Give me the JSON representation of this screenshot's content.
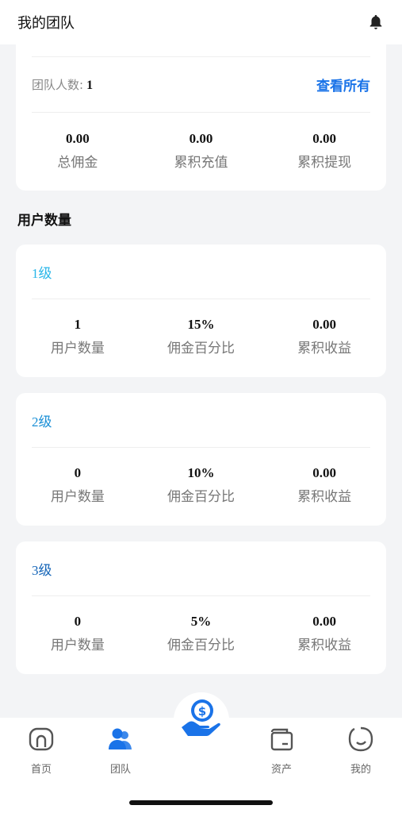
{
  "header": {
    "title": "我的团队"
  },
  "team": {
    "count_label": "团队人数:",
    "count_value": "1",
    "view_all": "查看所有",
    "stats": [
      {
        "value": "0.00",
        "label": "总佣金"
      },
      {
        "value": "0.00",
        "label": "累积充值"
      },
      {
        "value": "0.00",
        "label": "累积提现"
      }
    ]
  },
  "section_title": "用户数量",
  "levels": [
    {
      "title": "1级",
      "color": "#29b6e8",
      "stats": [
        {
          "value": "1",
          "label": "用户数量"
        },
        {
          "value": "15%",
          "label": "佣金百分比"
        },
        {
          "value": "0.00",
          "label": "累积收益"
        }
      ]
    },
    {
      "title": "2级",
      "color": "#1a8fd6",
      "stats": [
        {
          "value": "0",
          "label": "用户数量"
        },
        {
          "value": "10%",
          "label": "佣金百分比"
        },
        {
          "value": "0.00",
          "label": "累积收益"
        }
      ]
    },
    {
      "title": "3级",
      "color": "#1565b8",
      "stats": [
        {
          "value": "0",
          "label": "用户数量"
        },
        {
          "value": "5%",
          "label": "佣金百分比"
        },
        {
          "value": "0.00",
          "label": "累积收益"
        }
      ]
    }
  ],
  "tabbar": {
    "items": [
      {
        "label": "首页",
        "icon": "home-icon"
      },
      {
        "label": "团队",
        "icon": "team-icon",
        "active": true
      },
      {
        "label": "",
        "icon": "money-hand-icon",
        "center": true
      },
      {
        "label": "资产",
        "icon": "wallet-icon"
      },
      {
        "label": "我的",
        "icon": "profile-icon"
      }
    ],
    "active_color": "#1a73e8"
  }
}
